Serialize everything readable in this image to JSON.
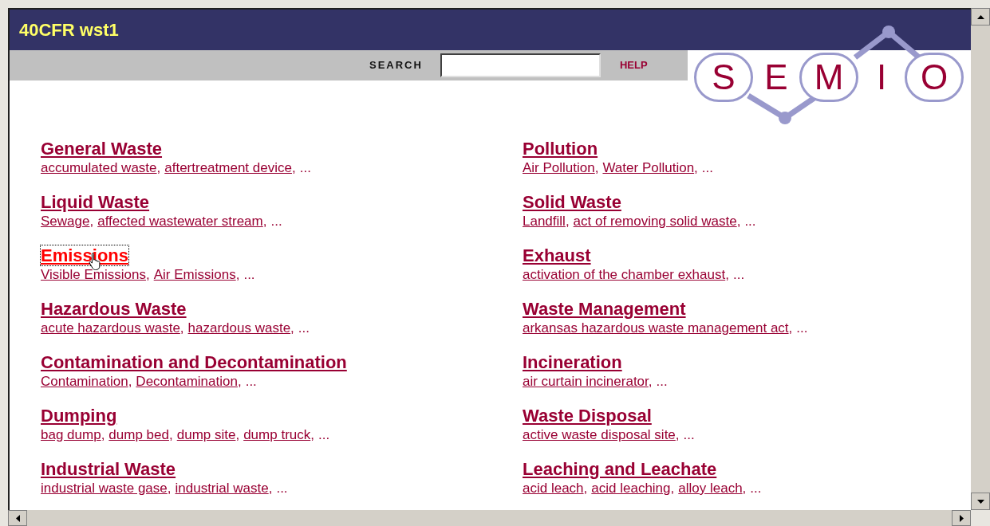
{
  "window": {
    "title": "40CFR wst1"
  },
  "search": {
    "label": "SEARCH"
  },
  "help": "HELP",
  "logo": [
    {
      "letter": "S",
      "circled": true
    },
    {
      "letter": "E",
      "circled": false
    },
    {
      "letter": "M",
      "circled": true
    },
    {
      "letter": "I",
      "circled": false
    },
    {
      "letter": "O",
      "circled": true
    }
  ],
  "separator": ",",
  "columns": [
    [
      {
        "title": "General Waste",
        "focused": false,
        "terms": [
          "accumulated waste",
          "aftertreatment device"
        ],
        "more": "..."
      },
      {
        "title": "Liquid Waste",
        "focused": false,
        "terms": [
          "Sewage",
          "affected wastewater stream"
        ],
        "more": "..."
      },
      {
        "title": "Emissions",
        "focused": true,
        "terms": [
          "Visible Emissions",
          "Air Emissions"
        ],
        "more": "..."
      },
      {
        "title": "Hazardous Waste",
        "focused": false,
        "terms": [
          "acute hazardous waste",
          "hazardous waste"
        ],
        "more": "..."
      },
      {
        "title": "Contamination and Decontamination",
        "focused": false,
        "terms": [
          "Contamination",
          "Decontamination"
        ],
        "more": "..."
      },
      {
        "title": "Dumping",
        "focused": false,
        "terms": [
          "bag dump",
          "dump bed",
          "dump site",
          "dump truck"
        ],
        "more": "..."
      },
      {
        "title": "Industrial Waste",
        "focused": false,
        "terms": [
          "industrial waste gase",
          "industrial waste"
        ],
        "more": "..."
      }
    ],
    [
      {
        "title": "Pollution",
        "focused": false,
        "terms": [
          "Air Pollution",
          "Water Pollution"
        ],
        "more": "..."
      },
      {
        "title": "Solid Waste",
        "focused": false,
        "terms": [
          "Landfill",
          "act of removing solid waste"
        ],
        "more": "..."
      },
      {
        "title": "Exhaust",
        "focused": false,
        "terms": [
          "activation of the chamber exhaust"
        ],
        "more": "..."
      },
      {
        "title": "Waste Management",
        "focused": false,
        "terms": [
          "arkansas hazardous waste management act"
        ],
        "more": "..."
      },
      {
        "title": "Incineration",
        "focused": false,
        "terms": [
          "air curtain incinerator"
        ],
        "more": "..."
      },
      {
        "title": "Waste Disposal",
        "focused": false,
        "terms": [
          "active waste disposal site"
        ],
        "more": "..."
      },
      {
        "title": "Leaching and Leachate",
        "focused": false,
        "terms": [
          "acid leach",
          "acid leaching",
          "alloy leach"
        ],
        "more": "..."
      }
    ]
  ]
}
